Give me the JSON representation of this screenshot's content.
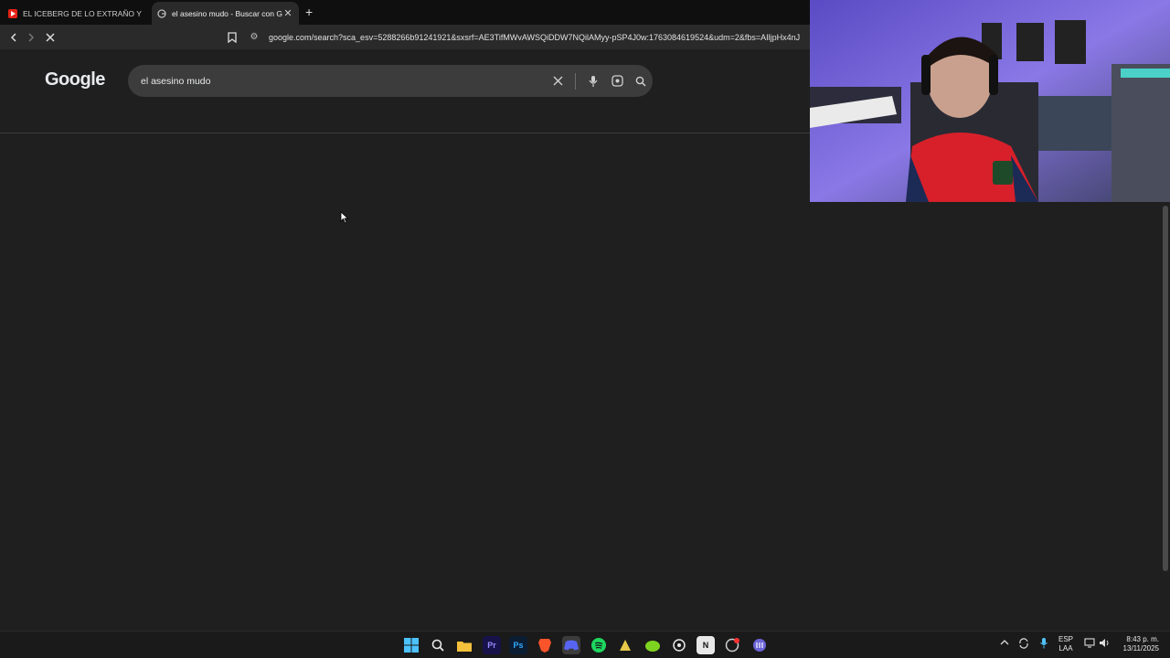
{
  "browser": {
    "tabs": [
      {
        "title": "EL ICEBERG DE LO EXTRAÑO Y PERTU",
        "icon": "youtube-icon"
      },
      {
        "title": "el asesino mudo - Buscar con Google",
        "icon": "google-icon"
      }
    ],
    "url": "google.com/search?sca_esv=5288266b91241921&sxsrf=AE3TifMWvAWSQiDDW7NQilAMyy-pSP4J0w:1763084619524&udm=2&fbs=AIljpHx4nJ"
  },
  "google": {
    "logo": "Google",
    "query": "el asesino mudo"
  },
  "taskbar": {
    "apps": [
      "windows-start-icon",
      "search-icon",
      "file-explorer-icon",
      "premiere-icon",
      "photoshop-icon",
      "brave-icon",
      "discord-icon",
      "spotify-icon",
      "app-icon",
      "android-icon",
      "steam-icon",
      "notion-icon",
      "chrome-icon",
      "app2-icon"
    ],
    "premiere_label": "Pr",
    "photoshop_label": "Ps",
    "notion_label": "N",
    "lang_top": "ESP",
    "lang_bottom": "LAA",
    "time": "8:43 p. m.",
    "date": "13/11/2025"
  }
}
